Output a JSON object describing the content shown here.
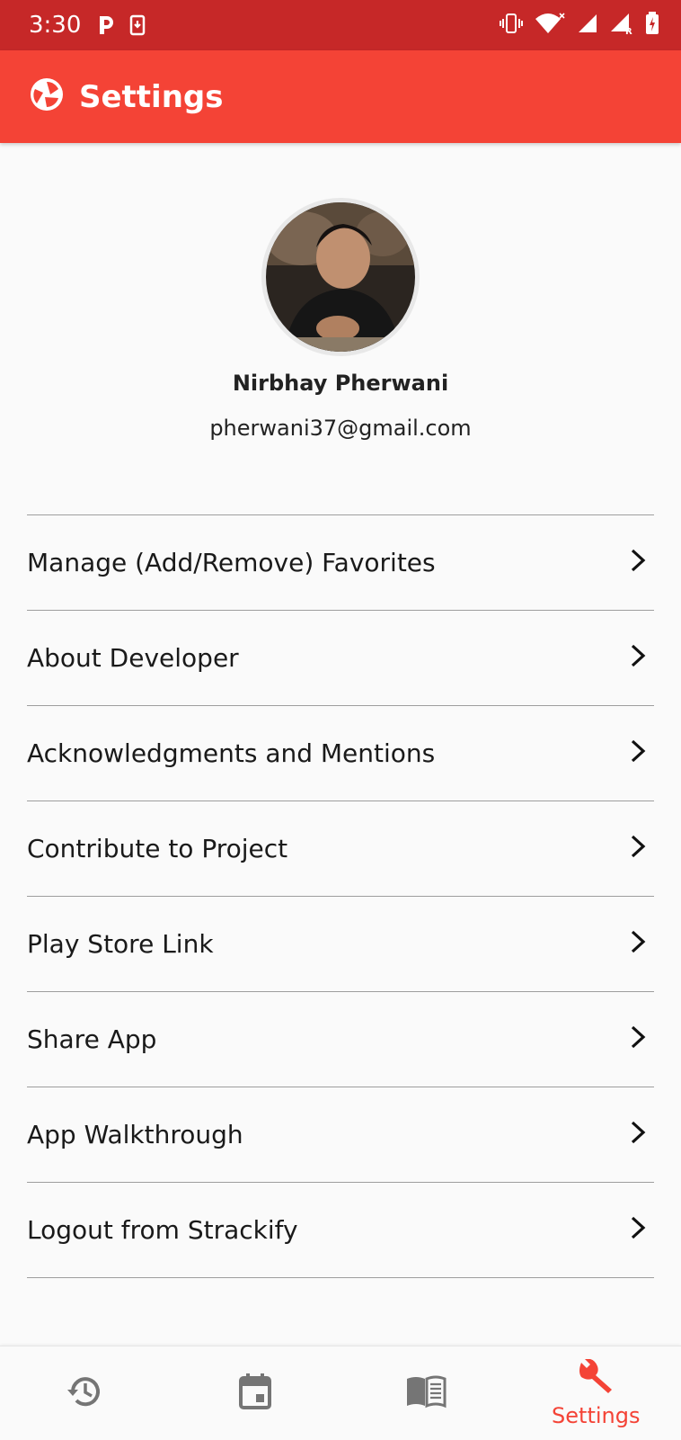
{
  "status_bar": {
    "time": "3:30"
  },
  "app_bar": {
    "title": "Settings"
  },
  "profile": {
    "name": "Nirbhay Pherwani",
    "email": "pherwani37@gmail.com"
  },
  "menu": {
    "items": [
      {
        "label": "Manage (Add/Remove) Favorites"
      },
      {
        "label": "About Developer"
      },
      {
        "label": "Acknowledgments and Mentions"
      },
      {
        "label": "Contribute to Project"
      },
      {
        "label": "Play Store Link"
      },
      {
        "label": "Share App"
      },
      {
        "label": "App Walkthrough"
      },
      {
        "label": "Logout from Strackify"
      }
    ]
  },
  "bottom_nav": {
    "items": [
      {
        "icon": "history-icon",
        "label": ""
      },
      {
        "icon": "calendar-icon",
        "label": ""
      },
      {
        "icon": "book-icon",
        "label": ""
      },
      {
        "icon": "wrench-icon",
        "label": "Settings",
        "active": true
      }
    ]
  },
  "colors": {
    "status_bar": "#c62828",
    "app_bar": "#f44336",
    "accent": "#f44336",
    "nav_icon_inactive": "#757575"
  }
}
